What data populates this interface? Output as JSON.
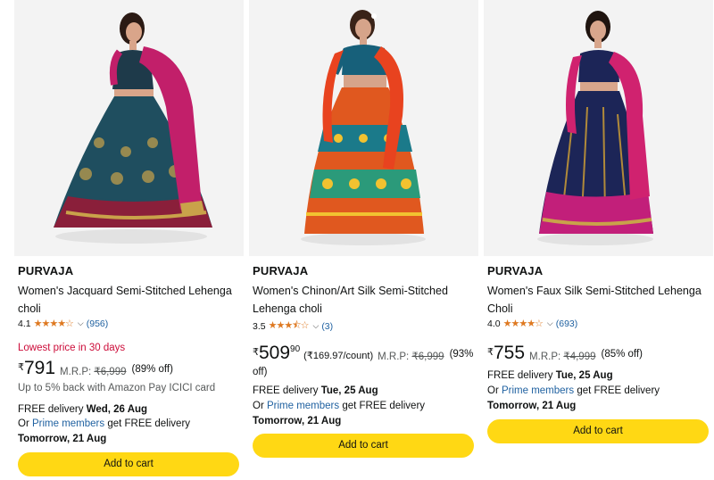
{
  "colors": {
    "accent_button": "#ffd814",
    "link": "#2162a1",
    "deal": "#cc0c39",
    "star": "#de7921"
  },
  "products": [
    {
      "brand": "PURVAJA",
      "title": "Women's Jacquard Semi-Stitched Lehenga choli",
      "rating": "4.1",
      "stars": 4,
      "review_count": "(956)",
      "deal_badge": "Lowest price in 30 days",
      "currency": "₹",
      "price_whole": "791",
      "price_fraction": "",
      "mrp_label": "M.R.P:",
      "mrp": "₹6,999",
      "discount": "(89% off)",
      "cashback": "Up to 5% back with Amazon Pay ICICI card",
      "delivery_prefix": "FREE delivery",
      "delivery_date": "Wed, 26 Aug",
      "prime_or": "Or",
      "prime_link": "Prime members",
      "prime_text": "get FREE delivery",
      "prime_date": "Tomorrow, 21 Aug",
      "button_label": "Add to cart",
      "image_icon": "lehenga-teal-pink-dupatta"
    },
    {
      "brand": "PURVAJA",
      "title": "Women's Chinon/Art Silk Semi-Stitched Lehenga choli",
      "rating": "3.5",
      "stars": 3.5,
      "review_count": "(3)",
      "currency": "₹",
      "price_whole": "509",
      "price_fraction": "90",
      "unit_price": "(₹169.97/count)",
      "mrp_label": "M.R.P:",
      "mrp": "₹6,999",
      "discount": "(93%",
      "discount_wrap": "off)",
      "delivery_prefix": "FREE delivery",
      "delivery_date": "Tue, 25 Aug",
      "prime_or": "Or",
      "prime_link": "Prime members",
      "prime_text": "get FREE delivery",
      "prime_date": "Tomorrow, 21 Aug",
      "button_label": "Add to cart",
      "image_icon": "lehenga-multicolor-orange-dupatta"
    },
    {
      "brand": "PURVAJA",
      "title": "Women's Faux Silk Semi-Stitched Lehenga Choli",
      "rating": "4.0",
      "stars": 4,
      "review_count": "(693)",
      "currency": "₹",
      "price_whole": "755",
      "price_fraction": "",
      "mrp_label": "M.R.P:",
      "mrp": "₹4,999",
      "discount": "(85% off)",
      "delivery_prefix": "FREE delivery",
      "delivery_date": "Tue, 25 Aug",
      "prime_or": "Or",
      "prime_link": "Prime members",
      "prime_text": "get FREE delivery",
      "prime_date": "Tomorrow, 21 Aug",
      "button_label": "Add to cart",
      "image_icon": "lehenga-navy-pink-dupatta"
    }
  ]
}
